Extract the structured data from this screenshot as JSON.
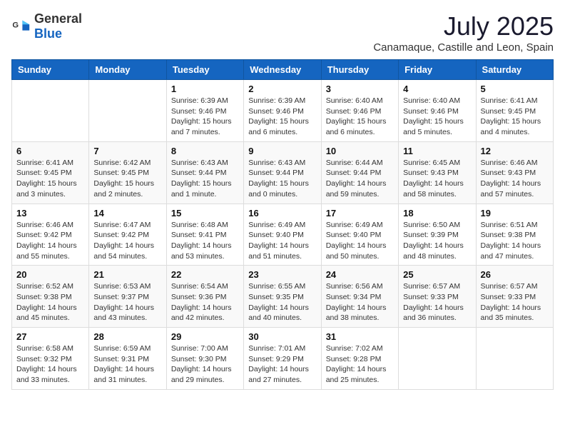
{
  "header": {
    "logo_general": "General",
    "logo_blue": "Blue",
    "month_year": "July 2025",
    "location": "Canamaque, Castille and Leon, Spain"
  },
  "weekdays": [
    "Sunday",
    "Monday",
    "Tuesday",
    "Wednesday",
    "Thursday",
    "Friday",
    "Saturday"
  ],
  "weeks": [
    [
      {
        "day": "",
        "info": ""
      },
      {
        "day": "",
        "info": ""
      },
      {
        "day": "1",
        "info": "Sunrise: 6:39 AM\nSunset: 9:46 PM\nDaylight: 15 hours\nand 7 minutes."
      },
      {
        "day": "2",
        "info": "Sunrise: 6:39 AM\nSunset: 9:46 PM\nDaylight: 15 hours\nand 6 minutes."
      },
      {
        "day": "3",
        "info": "Sunrise: 6:40 AM\nSunset: 9:46 PM\nDaylight: 15 hours\nand 6 minutes."
      },
      {
        "day": "4",
        "info": "Sunrise: 6:40 AM\nSunset: 9:46 PM\nDaylight: 15 hours\nand 5 minutes."
      },
      {
        "day": "5",
        "info": "Sunrise: 6:41 AM\nSunset: 9:45 PM\nDaylight: 15 hours\nand 4 minutes."
      }
    ],
    [
      {
        "day": "6",
        "info": "Sunrise: 6:41 AM\nSunset: 9:45 PM\nDaylight: 15 hours\nand 3 minutes."
      },
      {
        "day": "7",
        "info": "Sunrise: 6:42 AM\nSunset: 9:45 PM\nDaylight: 15 hours\nand 2 minutes."
      },
      {
        "day": "8",
        "info": "Sunrise: 6:43 AM\nSunset: 9:44 PM\nDaylight: 15 hours\nand 1 minute."
      },
      {
        "day": "9",
        "info": "Sunrise: 6:43 AM\nSunset: 9:44 PM\nDaylight: 15 hours\nand 0 minutes."
      },
      {
        "day": "10",
        "info": "Sunrise: 6:44 AM\nSunset: 9:44 PM\nDaylight: 14 hours\nand 59 minutes."
      },
      {
        "day": "11",
        "info": "Sunrise: 6:45 AM\nSunset: 9:43 PM\nDaylight: 14 hours\nand 58 minutes."
      },
      {
        "day": "12",
        "info": "Sunrise: 6:46 AM\nSunset: 9:43 PM\nDaylight: 14 hours\nand 57 minutes."
      }
    ],
    [
      {
        "day": "13",
        "info": "Sunrise: 6:46 AM\nSunset: 9:42 PM\nDaylight: 14 hours\nand 55 minutes."
      },
      {
        "day": "14",
        "info": "Sunrise: 6:47 AM\nSunset: 9:42 PM\nDaylight: 14 hours\nand 54 minutes."
      },
      {
        "day": "15",
        "info": "Sunrise: 6:48 AM\nSunset: 9:41 PM\nDaylight: 14 hours\nand 53 minutes."
      },
      {
        "day": "16",
        "info": "Sunrise: 6:49 AM\nSunset: 9:40 PM\nDaylight: 14 hours\nand 51 minutes."
      },
      {
        "day": "17",
        "info": "Sunrise: 6:49 AM\nSunset: 9:40 PM\nDaylight: 14 hours\nand 50 minutes."
      },
      {
        "day": "18",
        "info": "Sunrise: 6:50 AM\nSunset: 9:39 PM\nDaylight: 14 hours\nand 48 minutes."
      },
      {
        "day": "19",
        "info": "Sunrise: 6:51 AM\nSunset: 9:38 PM\nDaylight: 14 hours\nand 47 minutes."
      }
    ],
    [
      {
        "day": "20",
        "info": "Sunrise: 6:52 AM\nSunset: 9:38 PM\nDaylight: 14 hours\nand 45 minutes."
      },
      {
        "day": "21",
        "info": "Sunrise: 6:53 AM\nSunset: 9:37 PM\nDaylight: 14 hours\nand 43 minutes."
      },
      {
        "day": "22",
        "info": "Sunrise: 6:54 AM\nSunset: 9:36 PM\nDaylight: 14 hours\nand 42 minutes."
      },
      {
        "day": "23",
        "info": "Sunrise: 6:55 AM\nSunset: 9:35 PM\nDaylight: 14 hours\nand 40 minutes."
      },
      {
        "day": "24",
        "info": "Sunrise: 6:56 AM\nSunset: 9:34 PM\nDaylight: 14 hours\nand 38 minutes."
      },
      {
        "day": "25",
        "info": "Sunrise: 6:57 AM\nSunset: 9:33 PM\nDaylight: 14 hours\nand 36 minutes."
      },
      {
        "day": "26",
        "info": "Sunrise: 6:57 AM\nSunset: 9:33 PM\nDaylight: 14 hours\nand 35 minutes."
      }
    ],
    [
      {
        "day": "27",
        "info": "Sunrise: 6:58 AM\nSunset: 9:32 PM\nDaylight: 14 hours\nand 33 minutes."
      },
      {
        "day": "28",
        "info": "Sunrise: 6:59 AM\nSunset: 9:31 PM\nDaylight: 14 hours\nand 31 minutes."
      },
      {
        "day": "29",
        "info": "Sunrise: 7:00 AM\nSunset: 9:30 PM\nDaylight: 14 hours\nand 29 minutes."
      },
      {
        "day": "30",
        "info": "Sunrise: 7:01 AM\nSunset: 9:29 PM\nDaylight: 14 hours\nand 27 minutes."
      },
      {
        "day": "31",
        "info": "Sunrise: 7:02 AM\nSunset: 9:28 PM\nDaylight: 14 hours\nand 25 minutes."
      },
      {
        "day": "",
        "info": ""
      },
      {
        "day": "",
        "info": ""
      }
    ]
  ]
}
